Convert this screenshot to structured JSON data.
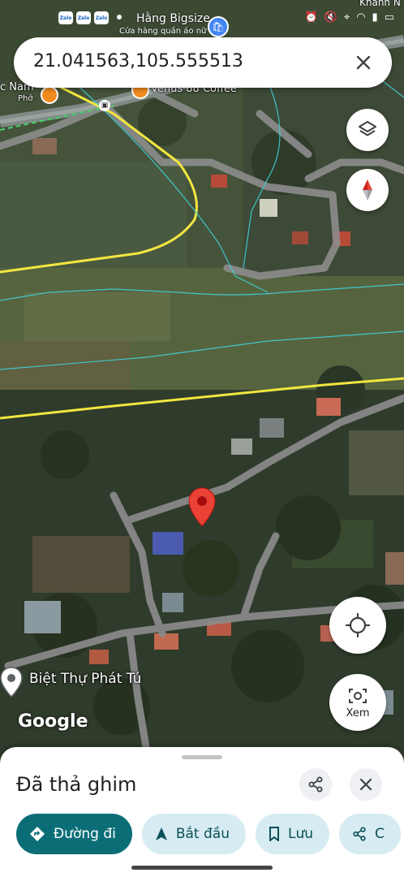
{
  "status_bar": {
    "apps": [
      "Zalo",
      "Zalo",
      "Zalo"
    ],
    "poi_title": "Hằng Bigsize",
    "poi_subtitle": "Cửa hàng quần áo nữ",
    "poi_extra": "Khánh N"
  },
  "search": {
    "value": "21.041563,105.555513"
  },
  "map": {
    "labels": {
      "left_fragment": "c Nam",
      "left_fragment_sub": "Phở",
      "venus": "Venus 88 Coffee"
    },
    "place": "Biệt Thự Phát Tú",
    "google_logo": "Google"
  },
  "controls": {
    "xem_label": "Xem"
  },
  "sheet": {
    "title": "Đã thả ghim",
    "chips": [
      {
        "label": "Đường đi"
      },
      {
        "label": "Bắt đầu"
      },
      {
        "label": "Lưu"
      },
      {
        "label": "C"
      }
    ]
  },
  "colors": {
    "accent": "#0b6e77",
    "chip_secondary": "#d6ecf2",
    "pin_red": "#ea4335",
    "boundary_yellow": "#f2e640",
    "cyan_line": "#3fd0d8"
  }
}
